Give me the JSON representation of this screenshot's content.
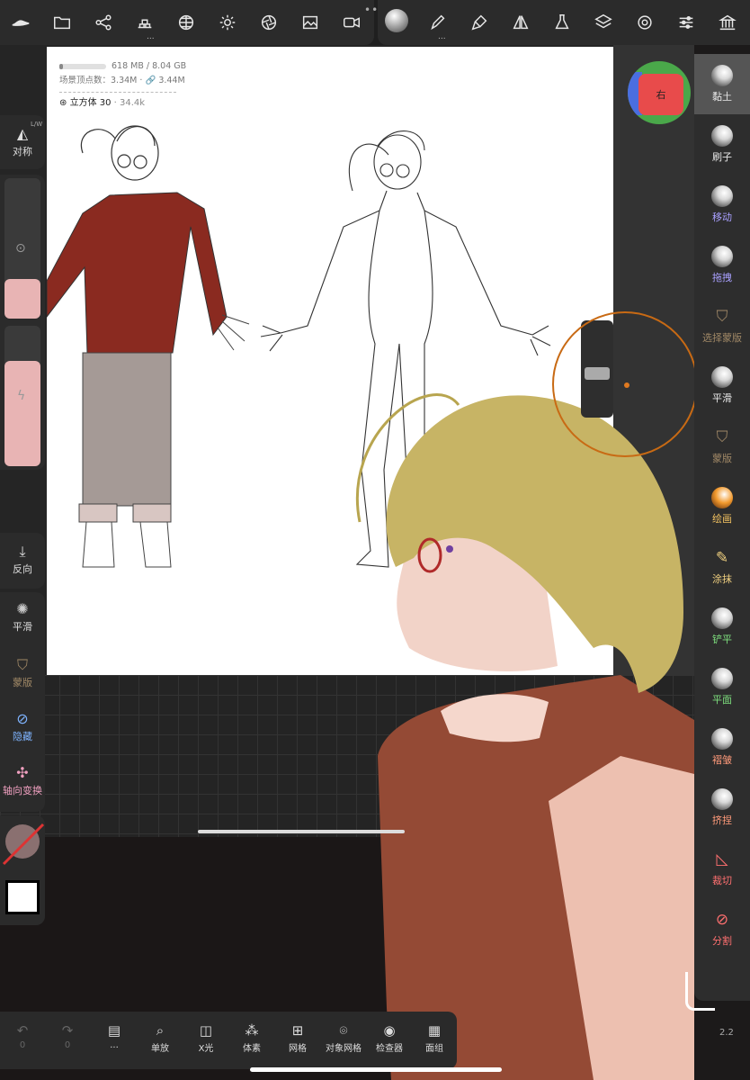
{
  "top_toolbar": {
    "left_icons": [
      "hat-icon",
      "folder-icon",
      "share-icon",
      "layers-cubes-icon",
      "globe-grid-icon",
      "sun-icon",
      "aperture-icon",
      "image-icon",
      "video-icon"
    ],
    "right_icons": [
      "material-ball-icon",
      "pen-icon",
      "brush-icon",
      "symmetry-icon",
      "flask-icon",
      "layers-icon",
      "gear-icon",
      "sliders-icon",
      "museum-icon"
    ],
    "more_dots": "..."
  },
  "stats": {
    "memory": "618 MB / 8.04 GB",
    "memory_fraction": 0.08,
    "vertex_label": "场景顶点数：",
    "vertex_value": "3.34M",
    "link_value": "3.44M",
    "object_name": "立方体 30",
    "object_count": "34.4k"
  },
  "gizmo": {
    "face_label": "右"
  },
  "left_panel": {
    "symmetry_label": "对称",
    "symmetry_badge": "L/W",
    "radius_fraction": 0.28,
    "intensity_fraction": 0.75,
    "reverse_label": "反向",
    "smooth_label": "平滑",
    "mask_label": "蒙版",
    "hide_label": "隐藏",
    "gizmo_label": "轴向变换"
  },
  "right_tools": [
    {
      "label": "黏土",
      "color": "#e8e8e8"
    },
    {
      "label": "刷子",
      "color": "#e8e8e8"
    },
    {
      "label": "移动",
      "color": "#a9a0ff"
    },
    {
      "label": "拖拽",
      "color": "#a9a0ff"
    },
    {
      "label": "选择蒙版",
      "color": "#a08866"
    },
    {
      "label": "平滑",
      "color": "#e8e8e8"
    },
    {
      "label": "蒙版",
      "color": "#a08866"
    },
    {
      "label": "绘画",
      "color": "#f0c060"
    },
    {
      "label": "涂抹",
      "color": "#f0d080"
    },
    {
      "label": "铲平",
      "color": "#7ee07e"
    },
    {
      "label": "平面",
      "color": "#7ee07e"
    },
    {
      "label": "褶皱",
      "color": "#ff9a7a"
    },
    {
      "label": "挤捏",
      "color": "#ff9a7a"
    },
    {
      "label": "裁切",
      "color": "#ff7070"
    },
    {
      "label": "分割",
      "color": "#ff7070"
    }
  ],
  "bottom_bar": {
    "undo_count": "0",
    "redo_count": "0",
    "book_label": "...",
    "zoom_label": "单放",
    "xray_label": "X光",
    "voxel_label": "体素",
    "mesh_label": "网格",
    "object_mesh_label": "对象网格",
    "inspector_label": "检查器",
    "face_group_label": "面组"
  },
  "version": "2.2"
}
